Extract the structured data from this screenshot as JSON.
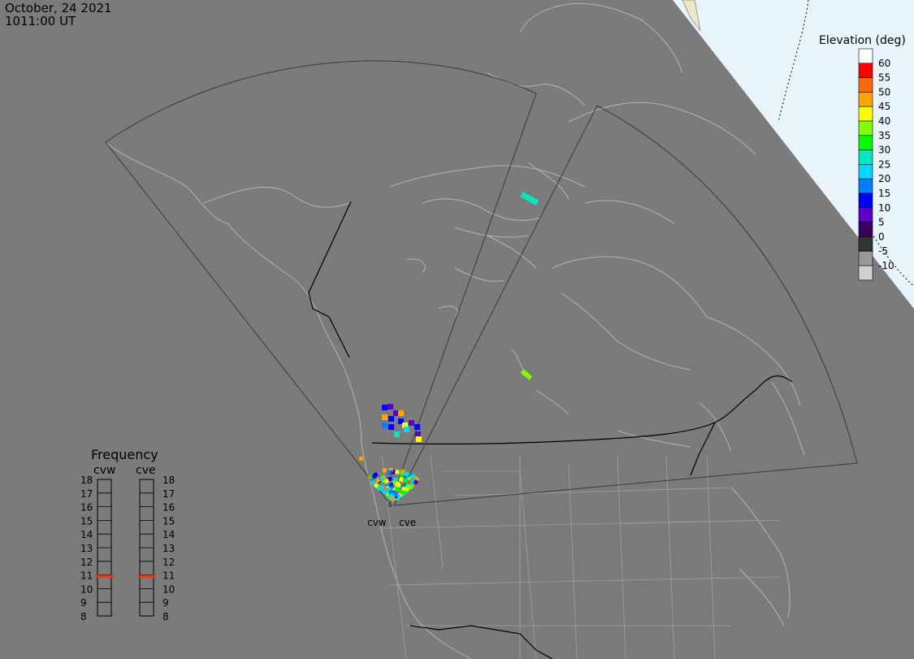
{
  "header": {
    "date": "October, 24 2021",
    "time": "1011:00 UT"
  },
  "radars": [
    {
      "code": "cvw",
      "label": "cvw"
    },
    {
      "code": "cve",
      "label": "cve"
    }
  ],
  "elevation_scale": {
    "title": "Elevation (deg)",
    "ticks": [
      "60",
      "55",
      "50",
      "45",
      "40",
      "35",
      "30",
      "25",
      "20",
      "15",
      "10",
      "5",
      "0",
      "-5",
      "-10"
    ],
    "colors": [
      "#ffffff",
      "#ff0000",
      "#ff6a00",
      "#ffa500",
      "#ffff00",
      "#80ff00",
      "#00ff00",
      "#00e8c0",
      "#00d8ff",
      "#0080ff",
      "#0000ff",
      "#5a00c8",
      "#3a0060",
      "#333333",
      "#999999",
      "#d0d0d0"
    ]
  },
  "frequency_panel": {
    "title": "Frequency",
    "columns": [
      {
        "label": "cvw",
        "marker_mhz": 10.9
      },
      {
        "label": "cve",
        "marker_mhz": 10.9
      }
    ],
    "ticks": [
      "18",
      "17",
      "16",
      "15",
      "14",
      "13",
      "12",
      "11",
      "10",
      "9",
      "8"
    ],
    "marker_color": "#ff3300"
  },
  "map_colors": {
    "ocean_background": "#7b7b7b",
    "night_region": "#7b7b7b",
    "day_region": "#e8f4fc",
    "coastline": "#b4b4b4",
    "border": "#000000",
    "fov_outline": "#3a3a3a"
  }
}
